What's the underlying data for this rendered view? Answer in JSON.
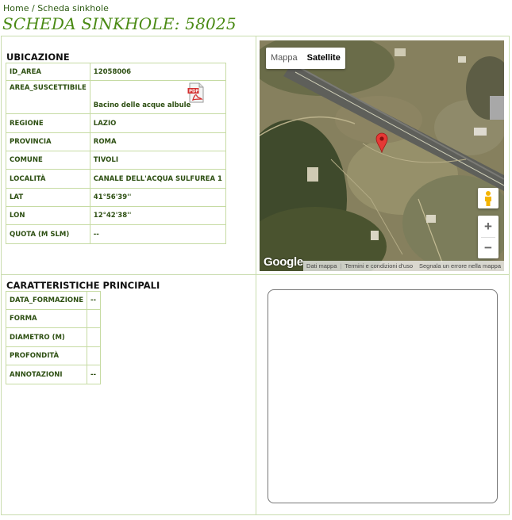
{
  "breadcrumb": {
    "home": "Home",
    "separator": " / ",
    "current": "Scheda sinkhole"
  },
  "page_title": "SCHEDA SINKHOLE: 58025",
  "ubicazione": {
    "heading": "UBICAZIONE",
    "rows": [
      {
        "key": "ID_AREA",
        "value": "12058006"
      },
      {
        "key": "AREA_SUSCETTIBILE",
        "value": "Bacino delle acque albule",
        "icon": "pdf-file-icon"
      },
      {
        "key": "REGIONE",
        "value": "LAZIO"
      },
      {
        "key": "PROVINCIA",
        "value": "ROMA"
      },
      {
        "key": "COMUNE",
        "value": "TIVOLI"
      },
      {
        "key": "LOCALITÀ",
        "value": "CANALE DELL'ACQUA SULFUREA 1"
      },
      {
        "key": "LAT",
        "value": "41°56'39''"
      },
      {
        "key": "LON",
        "value": "12°42'38''"
      },
      {
        "key": "QUOTA (M SLM)",
        "value": "--"
      }
    ]
  },
  "caratteristiche": {
    "heading": "CARATTERISTICHE PRINCIPALI",
    "rows": [
      {
        "key": "DATA_FORMAZIONE",
        "value": "--"
      },
      {
        "key": "FORMA",
        "value": ""
      },
      {
        "key": "DIAMETRO (M)",
        "value": ""
      },
      {
        "key": "PROFONDITÀ",
        "value": ""
      },
      {
        "key": "ANNOTAZIONI",
        "value": "--"
      }
    ]
  },
  "map": {
    "type_buttons": {
      "map": "Mappa",
      "satellite": "Satellite"
    },
    "selected_type": "Satellite",
    "zoom_in": "+",
    "zoom_out": "−",
    "logo": "Google",
    "attribution": {
      "data": "Dati mappa",
      "terms": "Termini e condizioni d'uso",
      "report": "Segnala un errore nella mappa"
    },
    "icons": {
      "pegman": "pegman-icon",
      "marker": "map-marker-icon"
    },
    "colors": {
      "marker": "#e53935",
      "pegman": "#f4b400"
    }
  }
}
